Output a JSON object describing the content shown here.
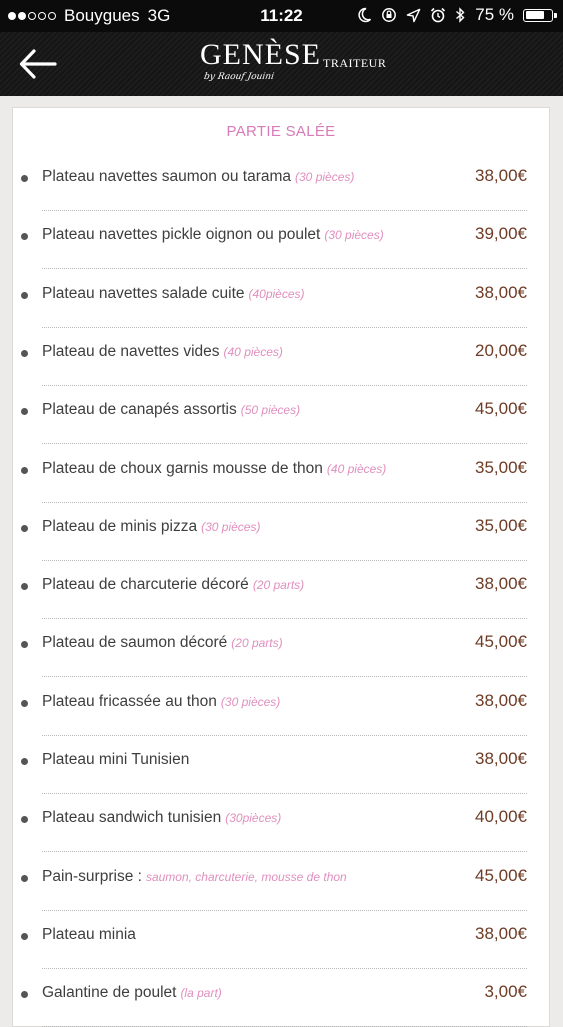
{
  "status_bar": {
    "carrier": "Bouygues",
    "network": "3G",
    "time": "11:22",
    "battery_text": "75 %",
    "battery_level": 0.75,
    "signal_bars": 2,
    "signal_total": 5
  },
  "header": {
    "logo_main": "GENÈSE",
    "logo_sub": "TRAITEUR",
    "logo_signature": "by Raouf Jouini"
  },
  "section": {
    "title": "PARTIE SALÉE"
  },
  "items": [
    {
      "name": "Plateau navettes saumon ou tarama",
      "qty": "(30 pièces)",
      "price": "38,00€"
    },
    {
      "name": "Plateau navettes pickle oignon ou poulet",
      "qty": "(30 pièces)",
      "price": "39,00€"
    },
    {
      "name": "Plateau navettes salade cuite",
      "qty": "(40pièces)",
      "price": "38,00€"
    },
    {
      "name": "Plateau de navettes vides",
      "qty": "(40 pièces)",
      "price": "20,00€"
    },
    {
      "name": "Plateau de canapés assortis",
      "qty": "(50 pièces)",
      "price": "45,00€"
    },
    {
      "name": "Plateau de choux garnis mousse de thon",
      "qty": "(40 pièces)",
      "price": "35,00€"
    },
    {
      "name": "Plateau de minis pizza",
      "qty": "(30 pièces)",
      "price": "35,00€"
    },
    {
      "name": "Plateau de charcuterie décoré",
      "qty": "(20 parts)",
      "price": "38,00€"
    },
    {
      "name": "Plateau de saumon décoré",
      "qty": "(20 parts)",
      "price": "45,00€"
    },
    {
      "name": "Plateau fricassée au thon",
      "qty": "(30 pièces)",
      "price": "38,00€"
    },
    {
      "name": "Plateau mini Tunisien",
      "qty": "",
      "price": "38,00€"
    },
    {
      "name": "Plateau sandwich tunisien",
      "qty": "(30pièces)",
      "price": "40,00€"
    },
    {
      "name": "Pain-surprise :",
      "qty": "saumon, charcuterie, mousse de thon",
      "price": "45,00€"
    },
    {
      "name": "Plateau minia",
      "qty": "",
      "price": "38,00€"
    },
    {
      "name": "Galantine de poulet",
      "qty": "(la part)",
      "price": "3,00€"
    }
  ],
  "colors": {
    "accent_pink": "#d87bb8",
    "price_brown": "#6e3b25",
    "header_bg": "#151515"
  }
}
